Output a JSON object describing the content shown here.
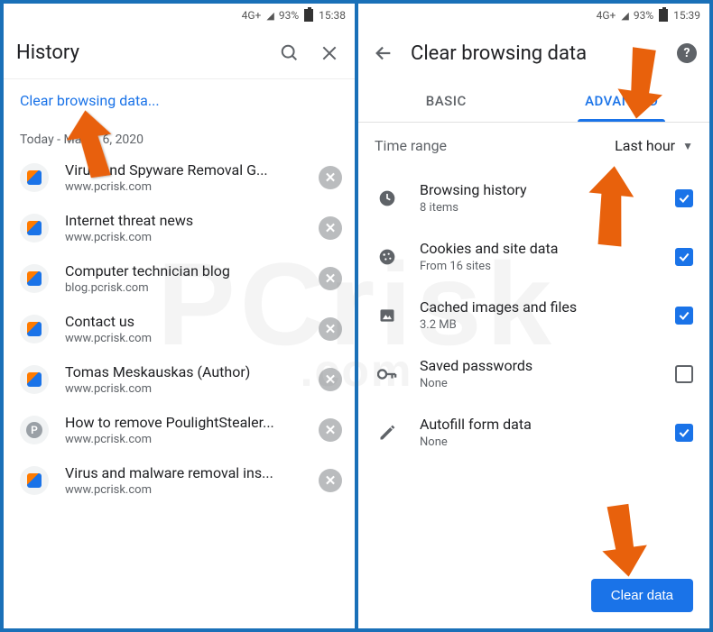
{
  "status_left": {
    "net": "4G+",
    "signal": "93%",
    "time": "15:38"
  },
  "status_right": {
    "net": "4G+",
    "signal": "93%",
    "time": "15:39"
  },
  "left_panel": {
    "title": "History",
    "clear_link": "Clear browsing data...",
    "date_header": "Today - March 6, 2020",
    "items": [
      {
        "title": "Virus and Spyware Removal G...",
        "url": "www.pcrisk.com",
        "fav": "pcrisk"
      },
      {
        "title": "Internet threat news",
        "url": "www.pcrisk.com",
        "fav": "pcrisk"
      },
      {
        "title": "Computer technician blog",
        "url": "blog.pcrisk.com",
        "fav": "pcrisk"
      },
      {
        "title": "Contact us",
        "url": "www.pcrisk.com",
        "fav": "pcrisk"
      },
      {
        "title": "Tomas Meskauskas (Author)",
        "url": "www.pcrisk.com",
        "fav": "pcrisk"
      },
      {
        "title": "How to remove PoulightStealer...",
        "url": "www.pcrisk.com",
        "fav": "grey"
      },
      {
        "title": "Virus and malware removal ins...",
        "url": "www.pcrisk.com",
        "fav": "pcrisk"
      }
    ]
  },
  "right_panel": {
    "title": "Clear browsing data",
    "tabs": [
      "BASIC",
      "ADVANCED"
    ],
    "active_tab": 1,
    "time_range": {
      "label": "Time range",
      "value": "Last hour"
    },
    "options": [
      {
        "icon": "clock",
        "title": "Browsing history",
        "sub": "8 items",
        "checked": true
      },
      {
        "icon": "cookie",
        "title": "Cookies and site data",
        "sub": "From 16 sites",
        "checked": true
      },
      {
        "icon": "image",
        "title": "Cached images and files",
        "sub": "3.2 MB",
        "checked": true
      },
      {
        "icon": "key",
        "title": "Saved passwords",
        "sub": "None",
        "checked": false
      },
      {
        "icon": "pencil",
        "title": "Autofill form data",
        "sub": "None",
        "checked": true
      }
    ],
    "clear_button": "Clear data"
  },
  "watermark": {
    "main": "PCrisk",
    "sub": ".com"
  }
}
